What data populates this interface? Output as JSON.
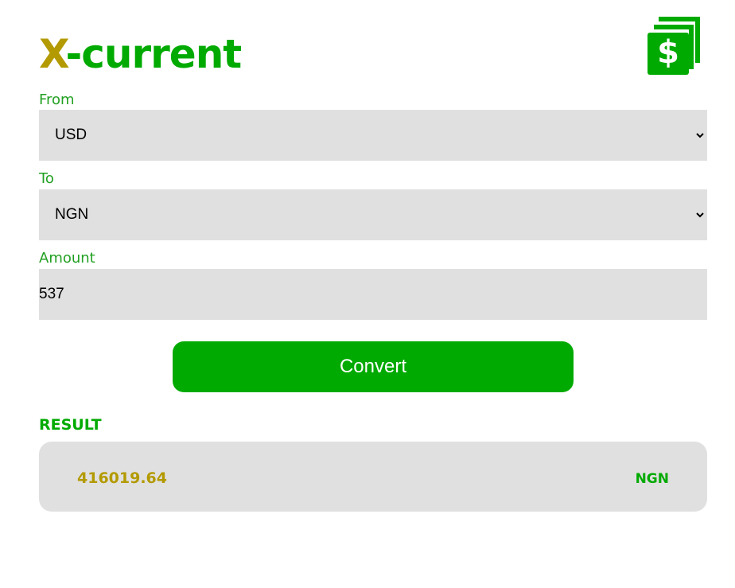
{
  "app": {
    "title_accent": "X",
    "title_main": "-current",
    "logo_icon": "money-bills-icon",
    "brand_color": "#00aa00",
    "accent_color": "#b39a00"
  },
  "form": {
    "from_label": "From",
    "from_value": "USD",
    "to_label": "To",
    "to_value": "NGN",
    "amount_label": "Amount",
    "amount_value": "537",
    "convert_label": "Convert"
  },
  "result": {
    "label": "RESULT",
    "value": "416019.64",
    "currency": "NGN"
  }
}
